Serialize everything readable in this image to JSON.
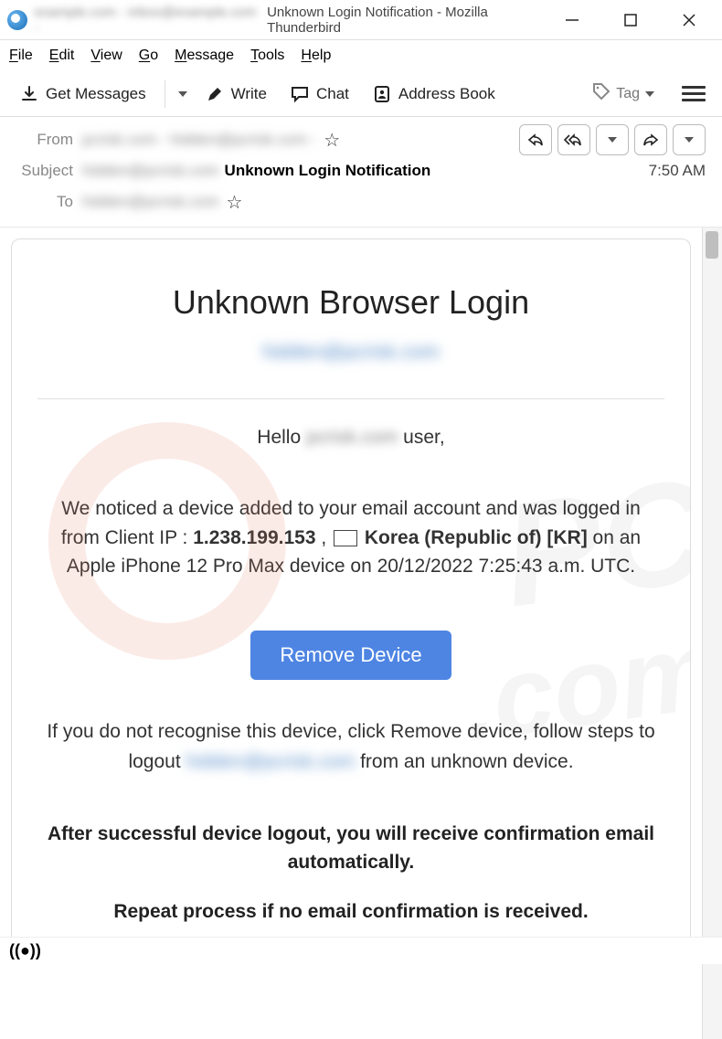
{
  "window": {
    "account_blur": "example.com - inbox@example.com -",
    "title": "Unknown Login Notification - Mozilla Thunderbird"
  },
  "menubar": {
    "file": "File",
    "edit": "Edit",
    "view": "View",
    "go": "Go",
    "message": "Message",
    "tools": "Tools",
    "help": "Help"
  },
  "toolbar": {
    "get_messages": "Get Messages",
    "write": "Write",
    "chat": "Chat",
    "address_book": "Address Book",
    "tag": "Tag"
  },
  "header": {
    "from_label": "From",
    "from_value": "pcrisk.com - hidden@pcrisk.com -",
    "subject_label": "Subject",
    "subject_blur": "hidden@pcrisk.com",
    "subject_value": "Unknown Login Notification",
    "time": "7:50 AM",
    "to_label": "To",
    "to_value": "hidden@pcrisk.com"
  },
  "email": {
    "title": "Unknown Browser Login",
    "subtitle_blur": "hidden@pcrisk.com",
    "hello_pre": "Hello ",
    "hello_blur": "pcrisk.com",
    "hello_post": " user,",
    "notice_pre": "We noticed a device added to your email account and was logged in from Client IP : ",
    "ip": "1.238.199.153",
    "sep": "  ,  ",
    "country": "Korea (Republic of) [KR]",
    "notice_post": " on an Apple iPhone 12 Pro Max device on 20/12/2022 7:25:43 a.m. UTC.",
    "cta": "Remove Device",
    "p2_pre": "If you do not recognise this device, click Remove device, follow steps to logout  ",
    "p2_blur": "hidden@pcrisk.com",
    "p2_post": "  from an unknown device.",
    "bold1": "After successful device logout, you will receive confirmation email automatically.",
    "bold2": "Repeat process if no email confirmation is received."
  }
}
